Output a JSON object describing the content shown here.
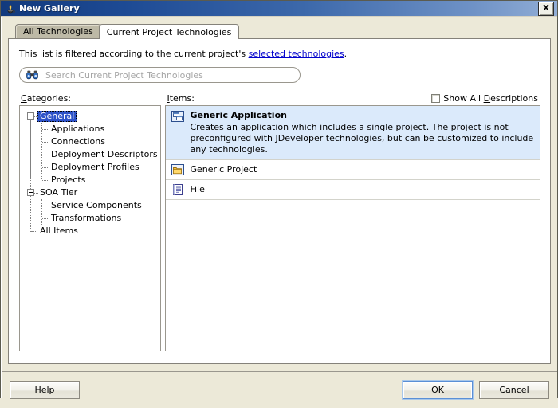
{
  "window": {
    "title": "New Gallery",
    "icon": "jdeveloper-lamp-icon",
    "close_label": "X"
  },
  "tabs": [
    {
      "label": "All Technologies",
      "active": false
    },
    {
      "label": "Current Project Technologies",
      "active": true
    }
  ],
  "filter_note": {
    "prefix": "This list is filtered according to the current project's ",
    "link": "selected technologies",
    "suffix": "."
  },
  "search": {
    "placeholder": "Search Current Project Technologies",
    "value": "",
    "icon": "binoculars-icon"
  },
  "categories_pane": {
    "header": "Categories:",
    "header_mnemonic": "C",
    "tree": [
      {
        "label": "General",
        "level": 0,
        "expanded": true,
        "selected": true
      },
      {
        "label": "Applications",
        "level": 1,
        "expanded": false,
        "selected": false
      },
      {
        "label": "Connections",
        "level": 1,
        "expanded": false,
        "selected": false
      },
      {
        "label": "Deployment Descriptors",
        "level": 1,
        "expanded": false,
        "selected": false
      },
      {
        "label": "Deployment Profiles",
        "level": 1,
        "expanded": false,
        "selected": false
      },
      {
        "label": "Projects",
        "level": 1,
        "expanded": false,
        "selected": false
      },
      {
        "label": "SOA Tier",
        "level": 0,
        "expanded": true,
        "selected": false
      },
      {
        "label": "Service Components",
        "level": 1,
        "expanded": false,
        "selected": false
      },
      {
        "label": "Transformations",
        "level": 1,
        "expanded": false,
        "selected": false
      },
      {
        "label": "All Items",
        "level": 0,
        "expanded": false,
        "selected": false
      }
    ]
  },
  "items_pane": {
    "header": "Items:",
    "header_mnemonic": "I",
    "show_all_descriptions": {
      "label_before": "Show All ",
      "label_mnemonic": "D",
      "label_after": "escriptions",
      "checked": false
    },
    "items": [
      {
        "title": "Generic Application",
        "description": "Creates an application which includes a single project. The project is not preconfigured with JDeveloper technologies, but can be customized to include any technologies.",
        "icon": "application-icon",
        "selected": true
      },
      {
        "title": "Generic Project",
        "description": "",
        "icon": "folder-icon",
        "selected": false
      },
      {
        "title": "File",
        "description": "",
        "icon": "file-icon",
        "selected": false
      }
    ]
  },
  "footer": {
    "help": {
      "before": "H",
      "mnemonic": "e",
      "after": "lp"
    },
    "ok": "OK",
    "cancel": "Cancel"
  },
  "colors": {
    "title_gradient_start": "#123a7d",
    "title_gradient_end": "#92aed6",
    "dialog_bg": "#ece9d8",
    "selection_blue": "#2d52c8",
    "item_selection_bg": "#dbeafb",
    "link": "#0000cc",
    "focus_border": "#5a8fd6"
  }
}
